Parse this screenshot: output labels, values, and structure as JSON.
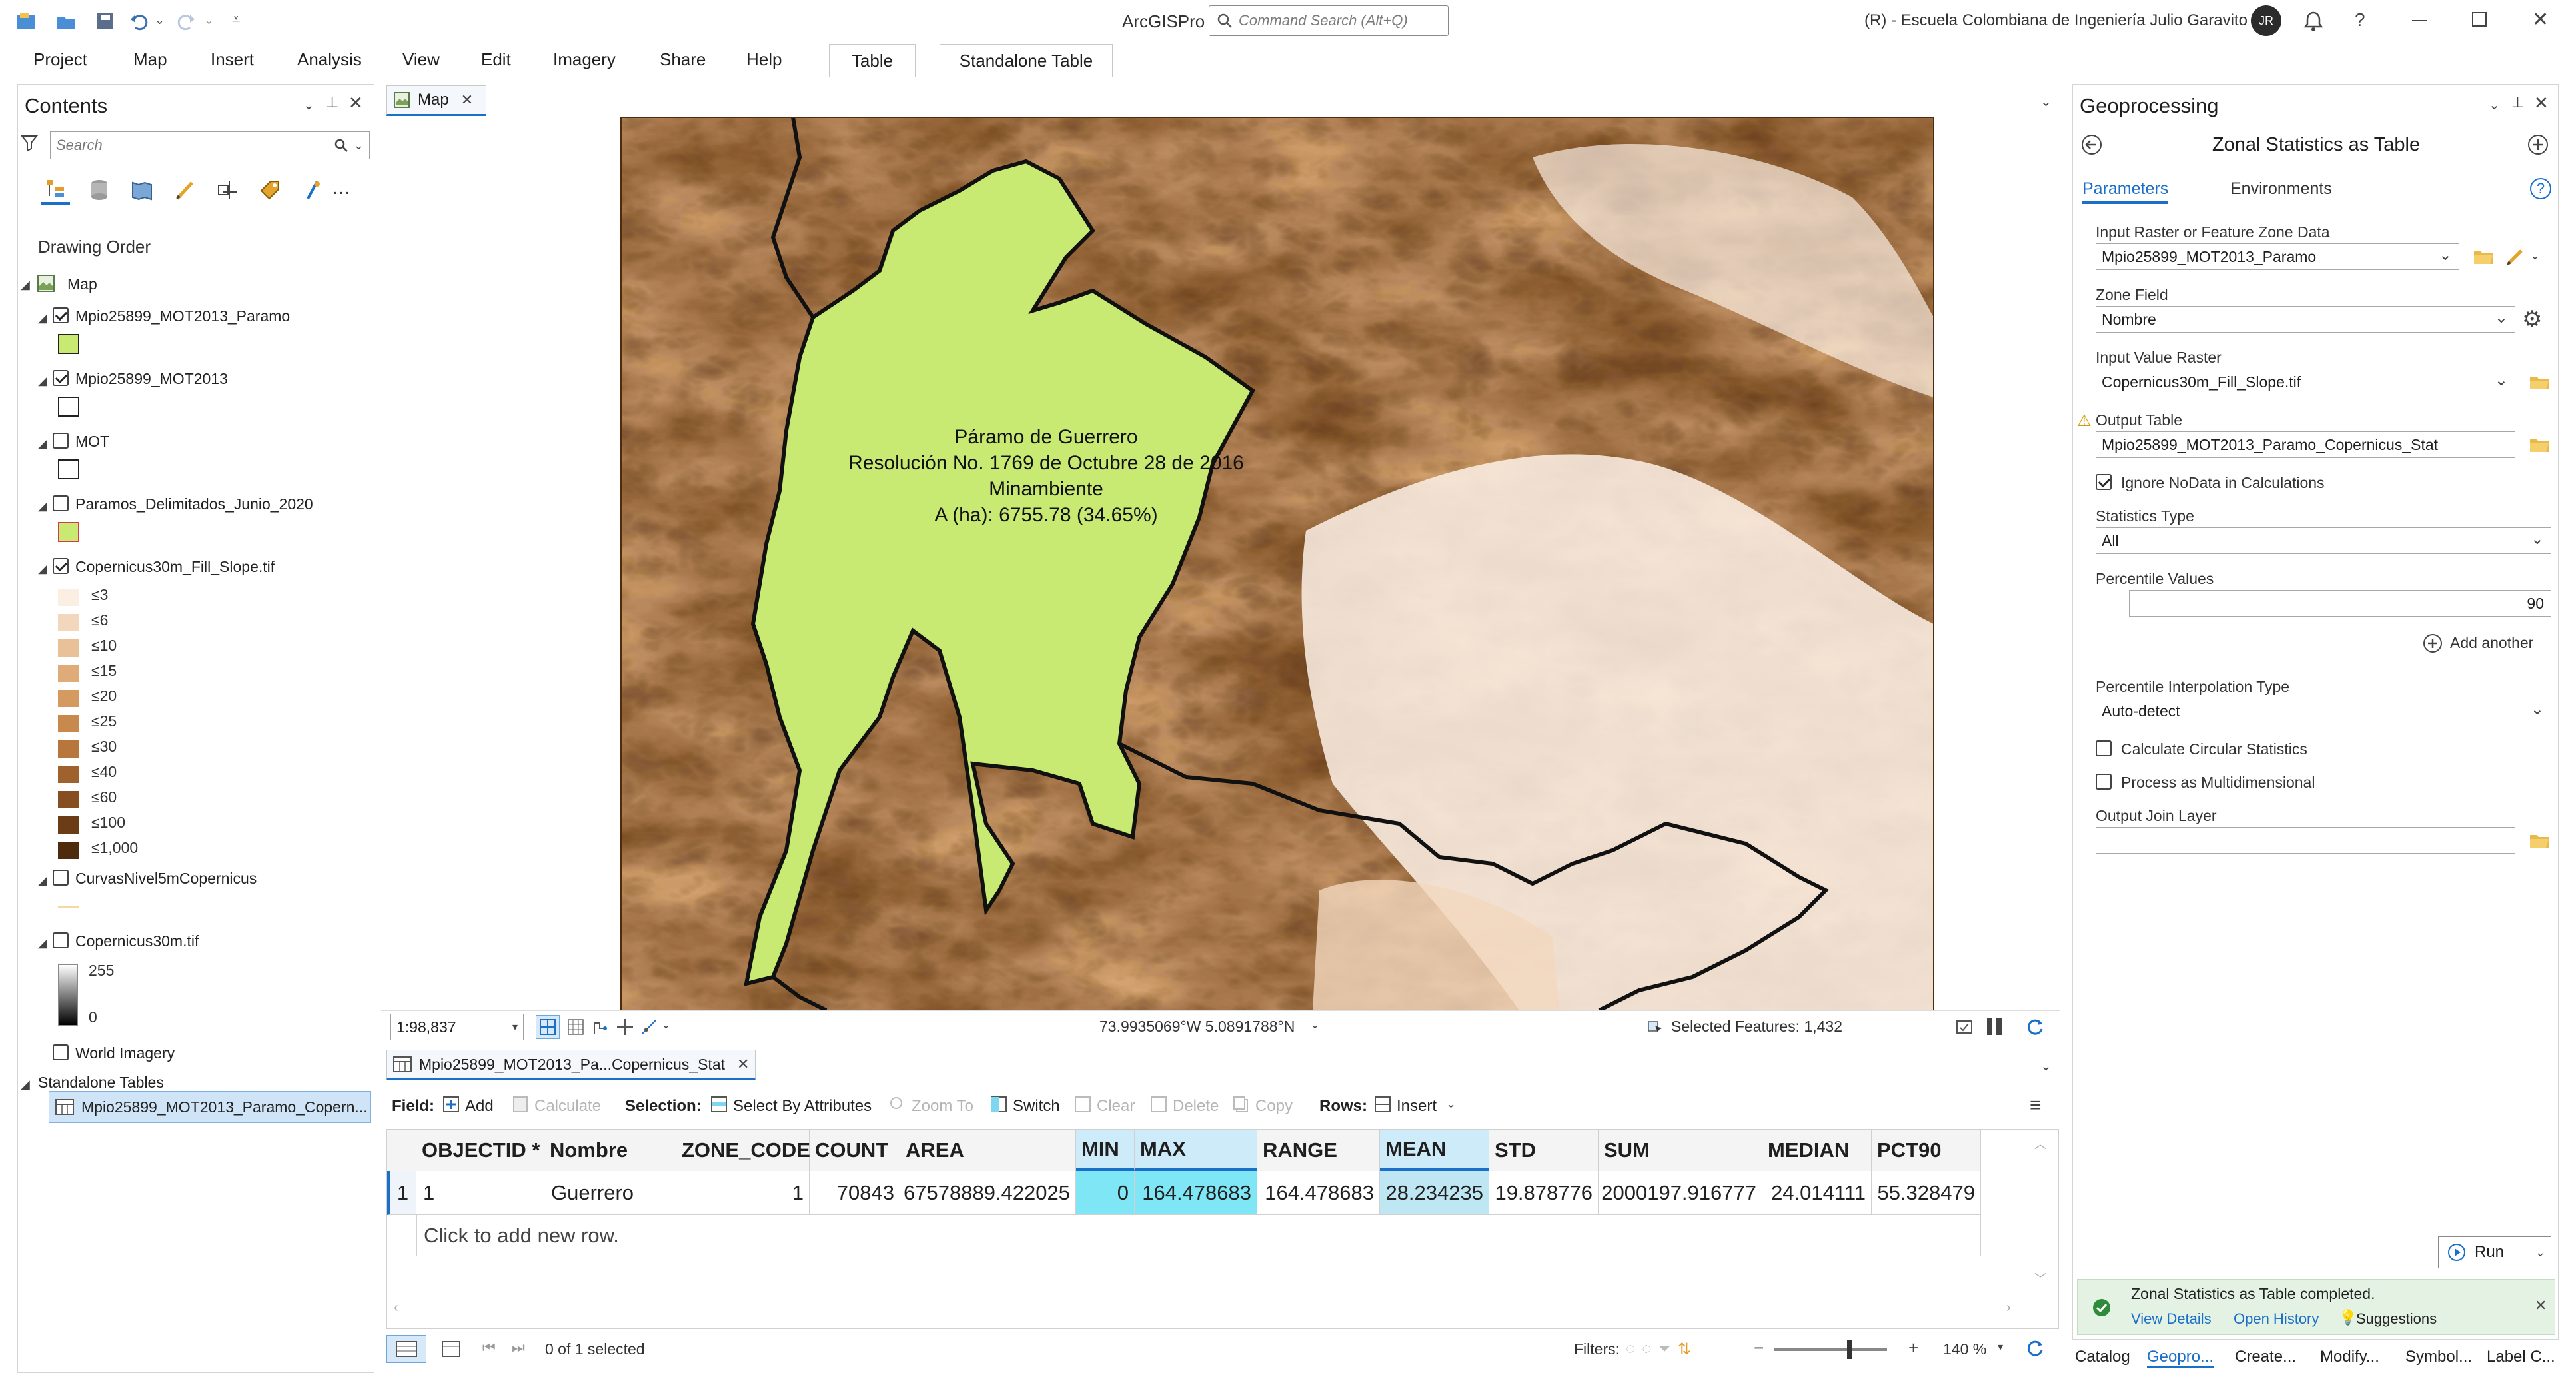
{
  "app": {
    "name": "ArcGISPro",
    "search_placeholder": "Command Search (Alt+Q)",
    "account": "(R) - Escuela Colombiana de Ingeniería Julio Garavito",
    "avatar_initials": "JR",
    "help": "?"
  },
  "menu": {
    "items": [
      "Project",
      "Map",
      "Insert",
      "Analysis",
      "View",
      "Edit",
      "Imagery",
      "Share",
      "Help"
    ],
    "context_tabs": [
      "Table",
      "Standalone Table"
    ]
  },
  "contents": {
    "title": "Contents",
    "search_placeholder": "Search",
    "drawing_order": "Drawing Order",
    "map": "Map",
    "layers": [
      {
        "name": "Mpio25899_MOT2013_Paramo",
        "checked": true
      },
      {
        "name": "Mpio25899_MOT2013",
        "checked": true
      },
      {
        "name": "MOT",
        "checked": false
      },
      {
        "name": "Paramos_Delimitados_Junio_2020",
        "checked": false
      },
      {
        "name": "Copernicus30m_Fill_Slope.tif",
        "checked": true
      },
      {
        "name": "CurvasNivel5mCopernicus",
        "checked": false
      },
      {
        "name": "Copernicus30m.tif",
        "checked": false
      },
      {
        "name": "World Imagery",
        "checked": false
      }
    ],
    "slope_legend": [
      "≤3",
      "≤6",
      "≤10",
      "≤15",
      "≤20",
      "≤25",
      "≤30",
      "≤40",
      "≤60",
      "≤100",
      "≤1,000"
    ],
    "slope_colors": [
      "#fbeee2",
      "#f2d7bd",
      "#e8c199",
      "#dfac79",
      "#d49a60",
      "#c8894c",
      "#b7763b",
      "#a0622c",
      "#864f20",
      "#6b3d16",
      "#4f2b0d"
    ],
    "dem_legend": {
      "high": "255",
      "low": "0"
    },
    "standalone_tables": "Standalone Tables",
    "standalone_item": "Mpio25899_MOT2013_Paramo_Copern..."
  },
  "map_view": {
    "tab": "Map",
    "label_lines": [
      "Páramo de Guerrero",
      "Resolución No. 1769 de Octubre 28 de 2016",
      "Minambiente",
      "A (ha): 6755.78 (34.65%)"
    ],
    "scale": "1:98,837",
    "coordinates": "73.9935069°W 5.0891788°N",
    "selected_features": "Selected Features: 1,432"
  },
  "attribute_table": {
    "tab": "Mpio25899_MOT2013_Pa...Copernicus_Stat",
    "field_label": "Field:",
    "add": "Add",
    "calculate": "Calculate",
    "selection_label": "Selection:",
    "select_by_attributes": "Select By Attributes",
    "zoom_to": "Zoom To",
    "switch": "Switch",
    "clear": "Clear",
    "delete": "Delete",
    "copy": "Copy",
    "rows_label": "Rows:",
    "insert": "Insert",
    "columns": [
      "OBJECTID *",
      "Nombre",
      "ZONE_CODE",
      "COUNT",
      "AREA",
      "MIN",
      "MAX",
      "RANGE",
      "MEAN",
      "STD",
      "SUM",
      "MEDIAN",
      "PCT90"
    ],
    "rows": [
      {
        "row_num": "1",
        "cells": [
          "1",
          "Guerrero",
          "1",
          "70843",
          "67578889.422025",
          "0",
          "164.478683",
          "164.478683",
          "28.234235",
          "19.878776",
          "2000197.916777",
          "24.014111",
          "55.328479"
        ]
      }
    ],
    "add_row": "Click to add new row.",
    "selection_status": "0 of 1 selected",
    "filters_label": "Filters:",
    "zoom": "140 %"
  },
  "geoprocessing": {
    "title": "Geoprocessing",
    "tool_title": "Zonal Statistics as Table",
    "tabs": [
      "Parameters",
      "Environments"
    ],
    "input_raster_label": "Input Raster or Feature Zone Data",
    "input_raster": "Mpio25899_MOT2013_Paramo",
    "zone_field_label": "Zone Field",
    "zone_field": "Nombre",
    "input_value_label": "Input Value Raster",
    "input_value": "Copernicus30m_Fill_Slope.tif",
    "output_table_label": "Output Table",
    "output_table": "Mpio25899_MOT2013_Paramo_Copernicus_Stat",
    "ignore_nodata": "Ignore NoData in Calculations",
    "statistics_type_label": "Statistics Type",
    "statistics_type": "All",
    "percentile_values_label": "Percentile Values",
    "percentile_value": "90",
    "add_another": "Add another",
    "interp_label": "Percentile Interpolation Type",
    "interp_value": "Auto-detect",
    "circular": "Calculate Circular Statistics",
    "multidim": "Process as Multidimensional",
    "join_layer_label": "Output Join Layer",
    "run": "Run",
    "message": "Zonal Statistics as Table completed.",
    "view_details": "View Details",
    "open_history": "Open History",
    "suggestions": "Suggestions"
  },
  "bottom_tabs": [
    "Catalog",
    "Geopro...",
    "Create...",
    "Modify...",
    "Symbol...",
    "Label C..."
  ]
}
